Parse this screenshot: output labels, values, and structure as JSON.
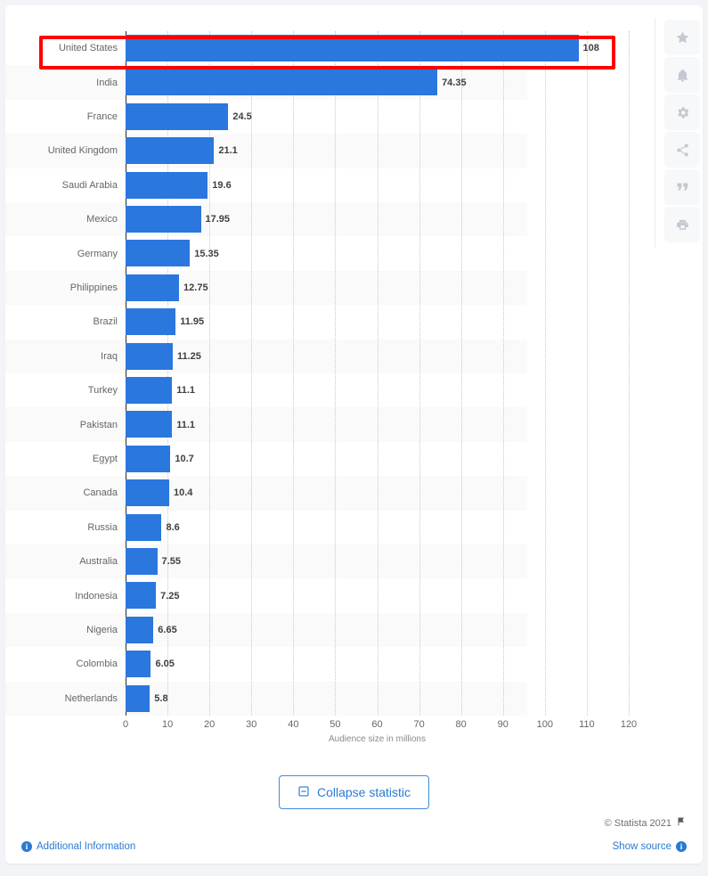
{
  "chart_data": {
    "type": "bar",
    "orientation": "horizontal",
    "title": "",
    "xlabel": "Audience size in millions",
    "ylabel": "",
    "xlim": [
      0,
      120
    ],
    "xticks": [
      0,
      10,
      20,
      30,
      40,
      50,
      60,
      70,
      80,
      90,
      100,
      110,
      120
    ],
    "grid": true,
    "legend": false,
    "bar_color": "#2a77de",
    "categories": [
      "United States",
      "India",
      "France",
      "United Kingdom",
      "Saudi Arabia",
      "Mexico",
      "Germany",
      "Philippines",
      "Brazil",
      "Iraq",
      "Turkey",
      "Pakistan",
      "Egypt",
      "Canada",
      "Russia",
      "Australia",
      "Indonesia",
      "Nigeria",
      "Colombia",
      "Netherlands"
    ],
    "values": [
      108,
      74.35,
      24.5,
      21.1,
      19.6,
      17.95,
      15.35,
      12.75,
      11.95,
      11.25,
      11.1,
      11.1,
      10.7,
      10.4,
      8.6,
      7.55,
      7.25,
      6.65,
      6.05,
      5.8
    ],
    "value_labels": [
      "108",
      "74.35",
      "24.5",
      "21.1",
      "19.6",
      "17.95",
      "15.35",
      "12.75",
      "11.95",
      "11.25",
      "11.1",
      "11.1",
      "10.7",
      "10.4",
      "8.6",
      "7.55",
      "7.25",
      "6.65",
      "6.05",
      "5.8"
    ],
    "highlighted_category": "United States",
    "highlight_color": "#ff0000"
  },
  "icon_rail": {
    "items": [
      {
        "name": "star-icon",
        "title": "Favorite"
      },
      {
        "name": "bell-icon",
        "title": "Notification"
      },
      {
        "name": "gear-icon",
        "title": "Settings"
      },
      {
        "name": "share-icon",
        "title": "Share"
      },
      {
        "name": "quote-icon",
        "title": "Citation"
      },
      {
        "name": "print-icon",
        "title": "Print"
      }
    ]
  },
  "controls": {
    "collapse_label": "Collapse statistic",
    "collapse_icon": "minus-square-icon"
  },
  "footer": {
    "copyright": "© Statista 2021",
    "flag_icon": "flag-icon",
    "additional_information": "Additional Information",
    "show_source": "Show source",
    "info_glyph": "i"
  }
}
